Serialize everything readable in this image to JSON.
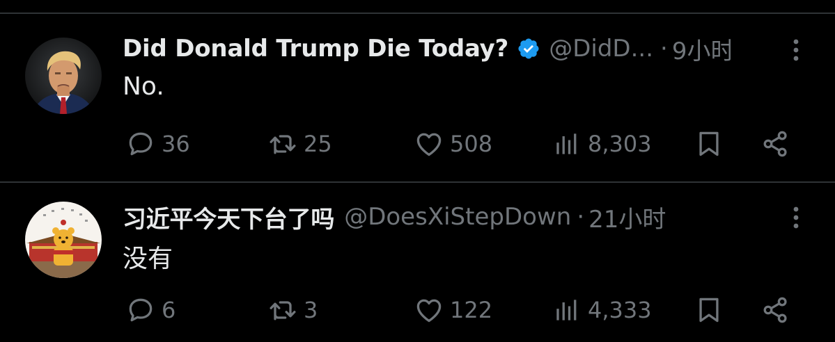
{
  "colors": {
    "background": "#000000",
    "text": "#e7e9ea",
    "secondary": "#71767b",
    "divider": "#2f3336",
    "verified": "#1d9bf0"
  },
  "tweets": [
    {
      "display_name": "Did Donald Trump Die Today?",
      "verified": true,
      "handle": "@DidD...",
      "separator": "·",
      "time": "9小时",
      "text": "No.",
      "replies": "36",
      "retweets": "25",
      "likes": "508",
      "views": "8,303"
    },
    {
      "display_name": "习近平今天下台了吗",
      "verified": false,
      "handle": "@DoesXiStepDown",
      "separator": "·",
      "time": "21小时",
      "text": "没有",
      "replies": "6",
      "retweets": "3",
      "likes": "122",
      "views": "4,333"
    }
  ]
}
